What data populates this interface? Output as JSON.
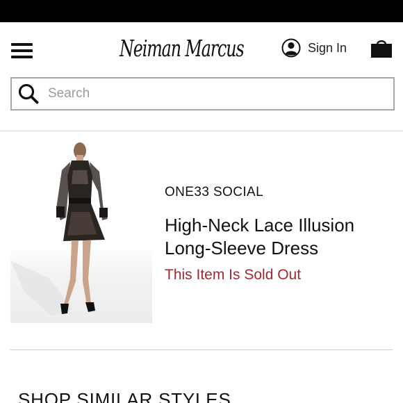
{
  "header": {
    "logo_text": "Neiman Marcus",
    "sign_in_label": "Sign In"
  },
  "search": {
    "placeholder": "Search",
    "value": ""
  },
  "product": {
    "brand": "ONE33 SOCIAL",
    "name": "High-Neck Lace Illusion Long-Sleeve Dress",
    "status": "This Item Is Sold Out"
  },
  "section": {
    "heading": "SHOP SIMILAR STYLES"
  },
  "icons": {
    "menu": "hamburger-menu-icon",
    "account": "user-account-icon",
    "bag": "shopping-bag-icon",
    "search": "search-icon"
  },
  "colors": {
    "sold_out": "#a4272f",
    "status_bar": "#000000",
    "divider": "#d9d9d9"
  }
}
